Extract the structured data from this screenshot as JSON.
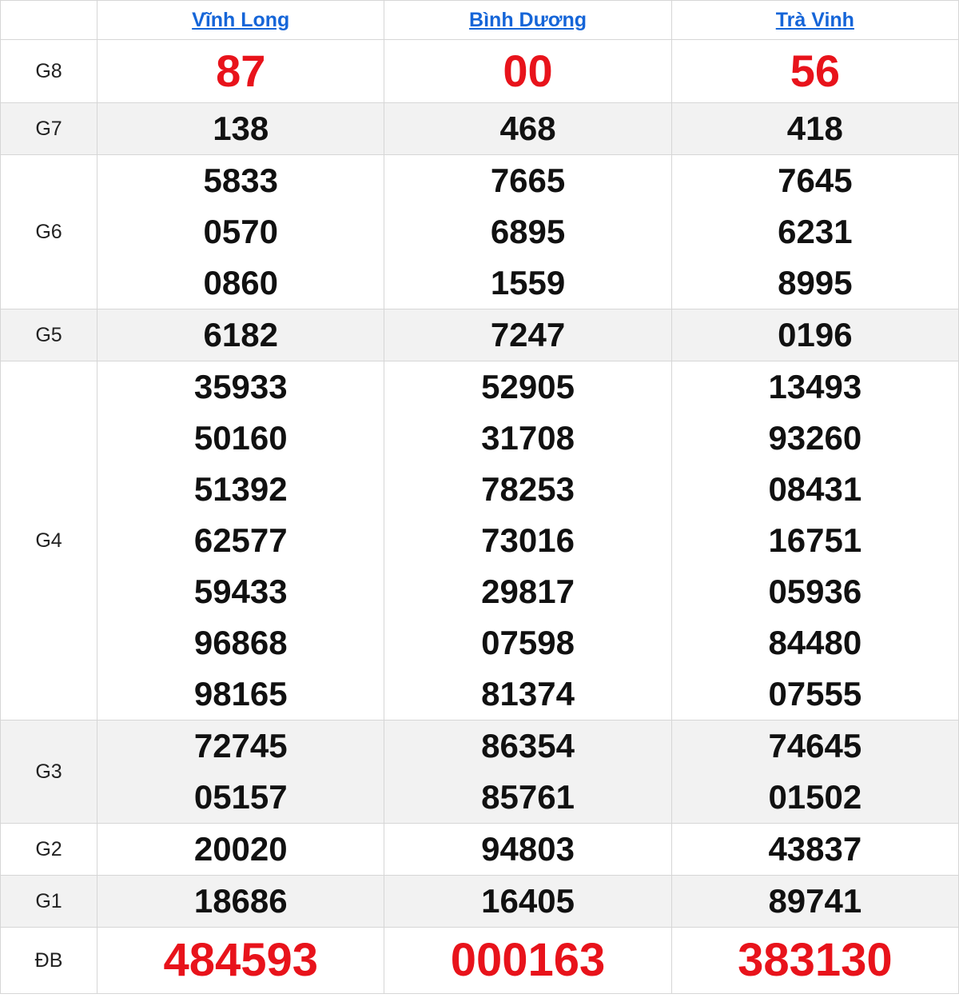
{
  "provinces": [
    "Vĩnh Long",
    "Bình Dương",
    "Trà Vinh"
  ],
  "colors": {
    "highlight": "#e8131b",
    "link": "#1565d8",
    "shade": "#f2f2f2"
  },
  "prizes": {
    "g8": {
      "label": "G8",
      "values": [
        [
          "87"
        ],
        [
          "00"
        ],
        [
          "56"
        ]
      ]
    },
    "g7": {
      "label": "G7",
      "values": [
        [
          "138"
        ],
        [
          "468"
        ],
        [
          "418"
        ]
      ]
    },
    "g6": {
      "label": "G6",
      "values": [
        [
          "5833",
          "0570",
          "0860"
        ],
        [
          "7665",
          "6895",
          "1559"
        ],
        [
          "7645",
          "6231",
          "8995"
        ]
      ]
    },
    "g5": {
      "label": "G5",
      "values": [
        [
          "6182"
        ],
        [
          "7247"
        ],
        [
          "0196"
        ]
      ]
    },
    "g4": {
      "label": "G4",
      "values": [
        [
          "35933",
          "50160",
          "51392",
          "62577",
          "59433",
          "96868",
          "98165"
        ],
        [
          "52905",
          "31708",
          "78253",
          "73016",
          "29817",
          "07598",
          "81374"
        ],
        [
          "13493",
          "93260",
          "08431",
          "16751",
          "05936",
          "84480",
          "07555"
        ]
      ]
    },
    "g3": {
      "label": "G3",
      "values": [
        [
          "72745",
          "05157"
        ],
        [
          "86354",
          "85761"
        ],
        [
          "74645",
          "01502"
        ]
      ]
    },
    "g2": {
      "label": "G2",
      "values": [
        [
          "20020"
        ],
        [
          "94803"
        ],
        [
          "43837"
        ]
      ]
    },
    "g1": {
      "label": "G1",
      "values": [
        [
          "18686"
        ],
        [
          "16405"
        ],
        [
          "89741"
        ]
      ]
    },
    "db": {
      "label": "ĐB",
      "values": [
        [
          "484593"
        ],
        [
          "000163"
        ],
        [
          "383130"
        ]
      ]
    }
  }
}
